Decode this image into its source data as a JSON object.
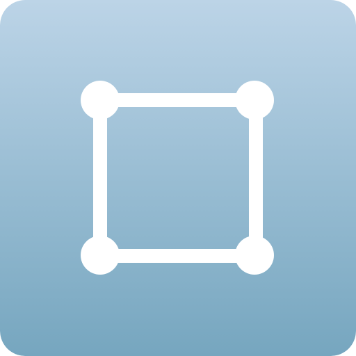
{
  "app_icon": {
    "icon_name": "selection-square-icon",
    "colors": {
      "gradient_top": "#bcd4e7",
      "gradient_bottom": "#76a6bf",
      "glyph": "#ffffff"
    }
  }
}
